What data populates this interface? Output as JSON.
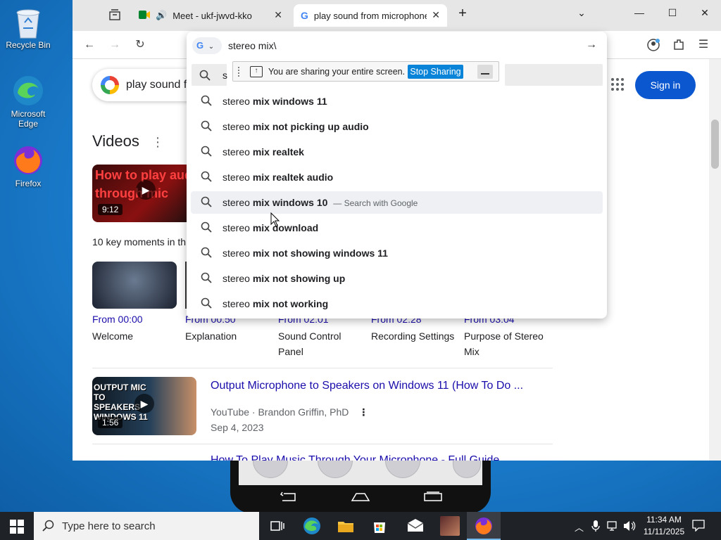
{
  "desktop": {
    "icons": [
      {
        "label": "Recycle Bin"
      },
      {
        "label": "Microsoft Edge"
      },
      {
        "label": "Firefox"
      }
    ]
  },
  "browser": {
    "tabs": [
      {
        "title": "Meet - ukf-jwvd-kko",
        "active": false
      },
      {
        "title": "play sound from microphone -",
        "active": true
      }
    ],
    "omnibox": {
      "engine_letter": "G",
      "typed": "stereo mix\\",
      "suggestions": [
        {
          "prefix": "stereo",
          "bold": "mix windows 11",
          "suffix": ""
        },
        {
          "prefix": "stereo",
          "bold": "mix not picking up audio",
          "suffix": ""
        },
        {
          "prefix": "stereo",
          "bold": "mix realtek",
          "suffix": ""
        },
        {
          "prefix": "stereo",
          "bold": "mix realtek audio",
          "suffix": ""
        },
        {
          "prefix": "stereo",
          "bold": "mix windows 10",
          "suffix": "— Search with Google",
          "highlighted": true
        },
        {
          "prefix": "stereo",
          "bold": "mix download",
          "suffix": ""
        },
        {
          "prefix": "stereo",
          "bold": "mix not showing windows 11",
          "suffix": ""
        },
        {
          "prefix": "stereo",
          "bold": "mix not showing up",
          "suffix": ""
        },
        {
          "prefix": "stereo",
          "bold": "mix not working",
          "suffix": ""
        }
      ]
    },
    "share_banner": {
      "message": "You are sharing your entire screen.",
      "stop_label": "Stop Sharing"
    },
    "page": {
      "search_query": "play sound f",
      "partial_search_letter": "s",
      "sign_in_label": "Sign in",
      "videos_heading": "Videos",
      "top_video": {
        "duration": "9:12",
        "thumb_text": "How to play audio through mic"
      },
      "key_moments_label": "10 key moments in th",
      "moments": [
        {
          "from": "From 00:00",
          "label": "Welcome"
        },
        {
          "from": "From 00:50",
          "label": "Explanation"
        },
        {
          "from": "From 02:01",
          "label": "Sound Control Panel"
        },
        {
          "from": "From 02:28",
          "label": "Recording Settings"
        },
        {
          "from": "From 03:04",
          "label": "Purpose of Stereo Mix"
        }
      ],
      "result": {
        "title": "Output Microphone to Speakers on Windows 11 (How To Do ...",
        "source": "YouTube · Brandon Griffin, PhD",
        "date": "Sep 4, 2023",
        "duration": "1:56",
        "thumb_text": "OUTPUT MIC TO SPEAKERS WINDOWS 11"
      },
      "next_result_partial": "How To Play Music Through Your Microphone - Full Guide"
    }
  },
  "taskbar": {
    "search_placeholder": "Type here to search",
    "time": "11:34 AM",
    "date": "11/11/2025"
  },
  "colors": {
    "google_blue": "#0b57d0",
    "link": "#1a0dab",
    "share_stop": "#0a84d8"
  }
}
